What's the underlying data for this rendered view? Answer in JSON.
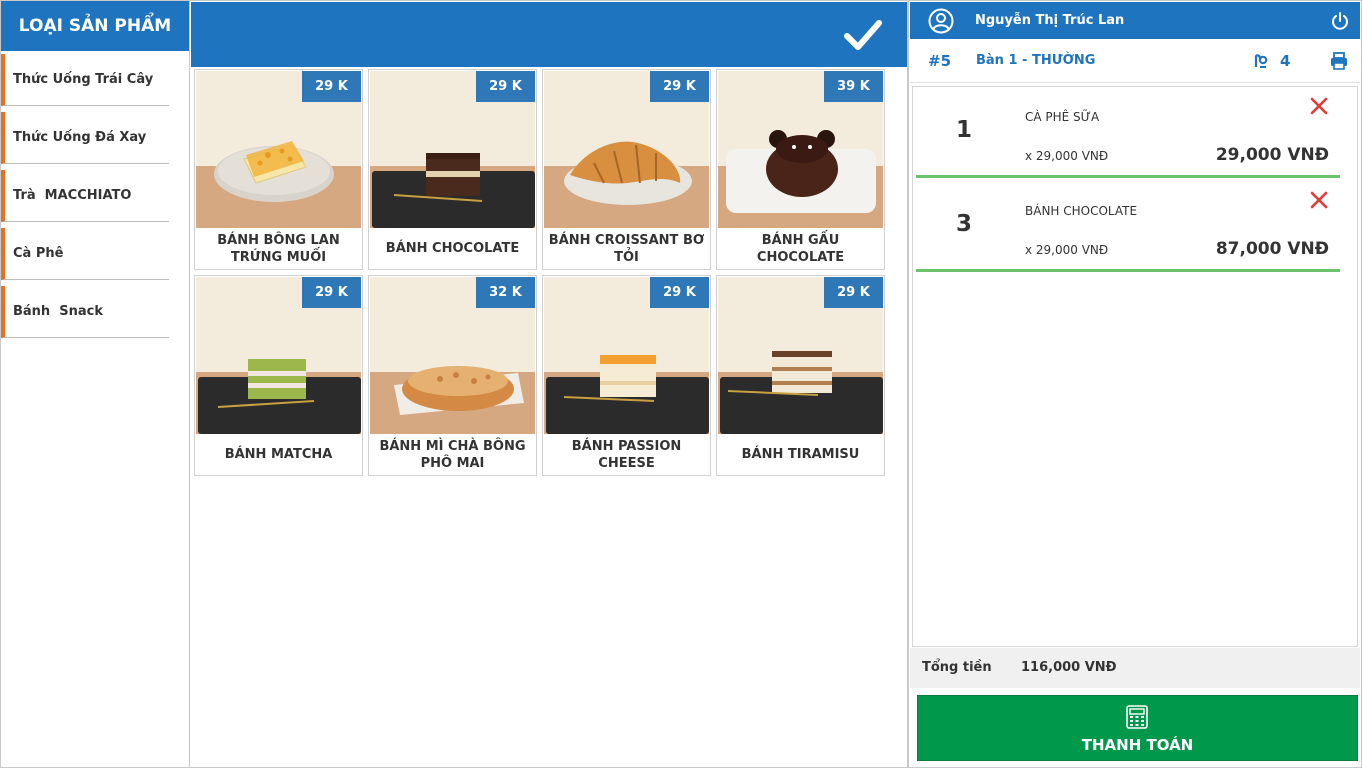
{
  "categories": {
    "title": "LOẠI SẢN PHẨM",
    "items": [
      {
        "label": "Thức Uống Trái Cây"
      },
      {
        "label": "Thức Uống Đá Xay"
      },
      {
        "label": "Trà  MACCHIATO"
      },
      {
        "label": "Cà Phê"
      },
      {
        "label": "Bánh  Snack"
      }
    ]
  },
  "products": [
    {
      "name": "BÁNH BÔNG LAN TRỨNG MUỐI",
      "price": "29 K"
    },
    {
      "name": "BÁNH CHOCOLATE",
      "price": "29 K"
    },
    {
      "name": "BÁNH CROISSANT BƠ TỎI",
      "price": "29 K"
    },
    {
      "name": "BÁNH GẤU CHOCOLATE",
      "price": "39 K"
    },
    {
      "name": "BÁNH MATCHA",
      "price": "29 K"
    },
    {
      "name": "BÁNH MÌ CHÀ BÔNG PHÔ MAI",
      "price": "32 K"
    },
    {
      "name": "BÁNH PASSION CHEESE",
      "price": "29 K"
    },
    {
      "name": "BÁNH TIRAMISU",
      "price": "29 K"
    }
  ],
  "header": {
    "user_name": "Nguyễn Thị Trúc Lan",
    "order_number": "#5",
    "table_name": "Bàn 1 - THƯỜNG",
    "guest_count": "4"
  },
  "order": {
    "items": [
      {
        "qty": "1",
        "name": "CÀ PHÊ SỮA",
        "unit_price": "x 29,000 VNĐ",
        "total": "29,000 VNĐ"
      },
      {
        "qty": "3",
        "name": "BÁNH CHOCOLATE",
        "unit_price": "x 29,000 VNĐ",
        "total": "87,000 VNĐ"
      }
    ],
    "total_label": "Tổng tiền",
    "total_value": "116,000 VNĐ",
    "pay_label": "THANH TOÁN"
  },
  "colors": {
    "primary": "#1f74c0",
    "category_accent": "#e8711f",
    "price_badge": "#2e78b7",
    "item_divider": "#6ac26b",
    "delete": "#e53935",
    "pay_button": "#00984a"
  },
  "icons": {
    "confirm": "check-icon",
    "user": "user-circle-icon",
    "logout": "power-icon",
    "guests": "guest-icon",
    "print": "printer-icon",
    "delete": "close-icon",
    "pay": "calculator-icon"
  }
}
